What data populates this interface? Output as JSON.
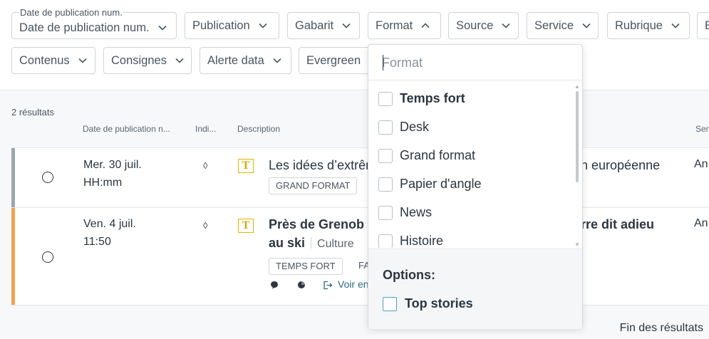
{
  "filters": {
    "floating_label": "Date de publication num.",
    "row1": [
      "Date de publication num.",
      "Publication",
      "Gabarit",
      "Format",
      "Source",
      "Service",
      "Rubrique",
      "E"
    ],
    "row2": [
      "Contenus",
      "Consignes",
      "Alerte data",
      "Evergreen"
    ]
  },
  "results": {
    "count": "2 résultats",
    "columns": {
      "date": "Date de publication n...",
      "indic": "Indi...",
      "description": "Description",
      "service": "Ser"
    },
    "rows": [
      {
        "stripe_color": "#9ba7b0",
        "date_line1": "Mer. 30 juil.",
        "date_line2": "HH:mm",
        "title_left": "Les idées d’extrêm",
        "title_right": "on européenne",
        "tags": [
          "GRAND FORMAT"
        ],
        "service": "An"
      },
      {
        "stripe_color": "#f0a34a",
        "date_line1": "Ven. 4 juil.",
        "date_line2": "11:50",
        "title_left": "Près de Grenob",
        "title_right": "erre dit adieu",
        "title_line2": "au ski",
        "rubrique": "Culture",
        "tags": [
          "TEMPS FORT",
          "FA"
        ],
        "voir": "Voir en",
        "service": "An"
      }
    ],
    "end_text": "Fin des résultats"
  },
  "dropdown": {
    "placeholder": "Format",
    "options": [
      "Temps fort",
      "Desk",
      "Grand format",
      "Papier d'angle",
      "News",
      "Histoire"
    ],
    "options_label": "Options:",
    "top_stories": "Top stories"
  },
  "colors": {
    "accent": "#4aa3b8",
    "t_icon": "#d8a900",
    "link": "#2b6b86"
  }
}
